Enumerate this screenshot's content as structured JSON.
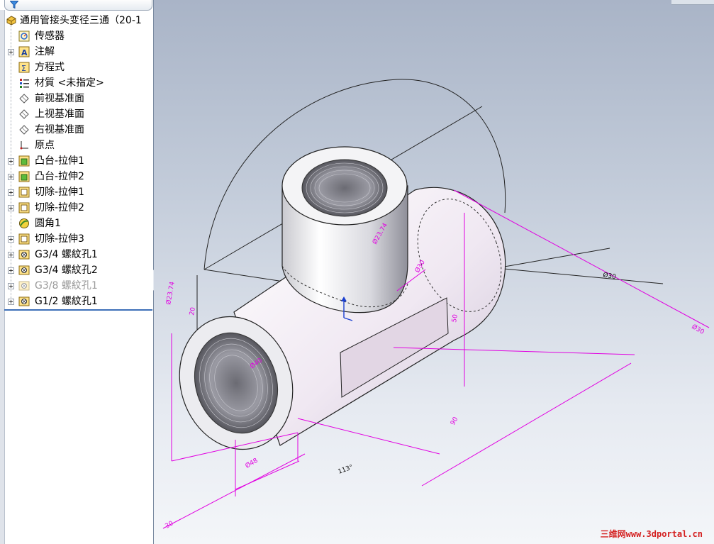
{
  "feature_tree": {
    "root": {
      "label": "通用管接头变径三通（20-1",
      "icon": "part-icon"
    },
    "items": [
      {
        "label": "传感器",
        "icon": "sensor-icon",
        "expandable": false
      },
      {
        "label": "注解",
        "icon": "annotation-icon",
        "expandable": true
      },
      {
        "label": "方程式",
        "icon": "equation-icon",
        "expandable": false
      },
      {
        "label": "材質 <未指定>",
        "icon": "material-icon",
        "expandable": false
      },
      {
        "label": "前视基准面",
        "icon": "plane-icon",
        "expandable": false
      },
      {
        "label": "上视基准面",
        "icon": "plane-icon",
        "expandable": false
      },
      {
        "label": "右视基准面",
        "icon": "plane-icon",
        "expandable": false
      },
      {
        "label": "原点",
        "icon": "origin-icon",
        "expandable": false
      },
      {
        "label": "凸台-拉伸1",
        "icon": "boss-extrude-icon",
        "expandable": true
      },
      {
        "label": "凸台-拉伸2",
        "icon": "boss-extrude-icon",
        "expandable": true
      },
      {
        "label": "切除-拉伸1",
        "icon": "cut-extrude-icon",
        "expandable": true
      },
      {
        "label": "切除-拉伸2",
        "icon": "cut-extrude-icon",
        "expandable": true
      },
      {
        "label": "圆角1",
        "icon": "fillet-icon",
        "expandable": false
      },
      {
        "label": "切除-拉伸3",
        "icon": "cut-extrude-icon",
        "expandable": true
      },
      {
        "label": "G3/4 螺紋孔1",
        "icon": "hole-wizard-icon",
        "expandable": true
      },
      {
        "label": "G3/4 螺紋孔2",
        "icon": "hole-wizard-icon",
        "expandable": true
      },
      {
        "label": "G3/8 螺紋孔1",
        "icon": "hole-wizard-icon",
        "expandable": true,
        "suppressed": true
      },
      {
        "label": "G1/2 螺紋孔1",
        "icon": "hole-wizard-icon",
        "expandable": true
      }
    ]
  },
  "viewport": {
    "dimension_labels": [
      "Ø40",
      "Ø23.74",
      "20",
      "Ø23.74",
      "90",
      "Ø30",
      "113°",
      "Ø30",
      "50",
      "Ø30",
      "30",
      "Ø48"
    ]
  },
  "watermark": "三维网www.3dportal.cn",
  "colors": {
    "dimension": "#e100e1",
    "sketch": "#1a1a1a",
    "selection_blue": "#3d6fb8"
  }
}
